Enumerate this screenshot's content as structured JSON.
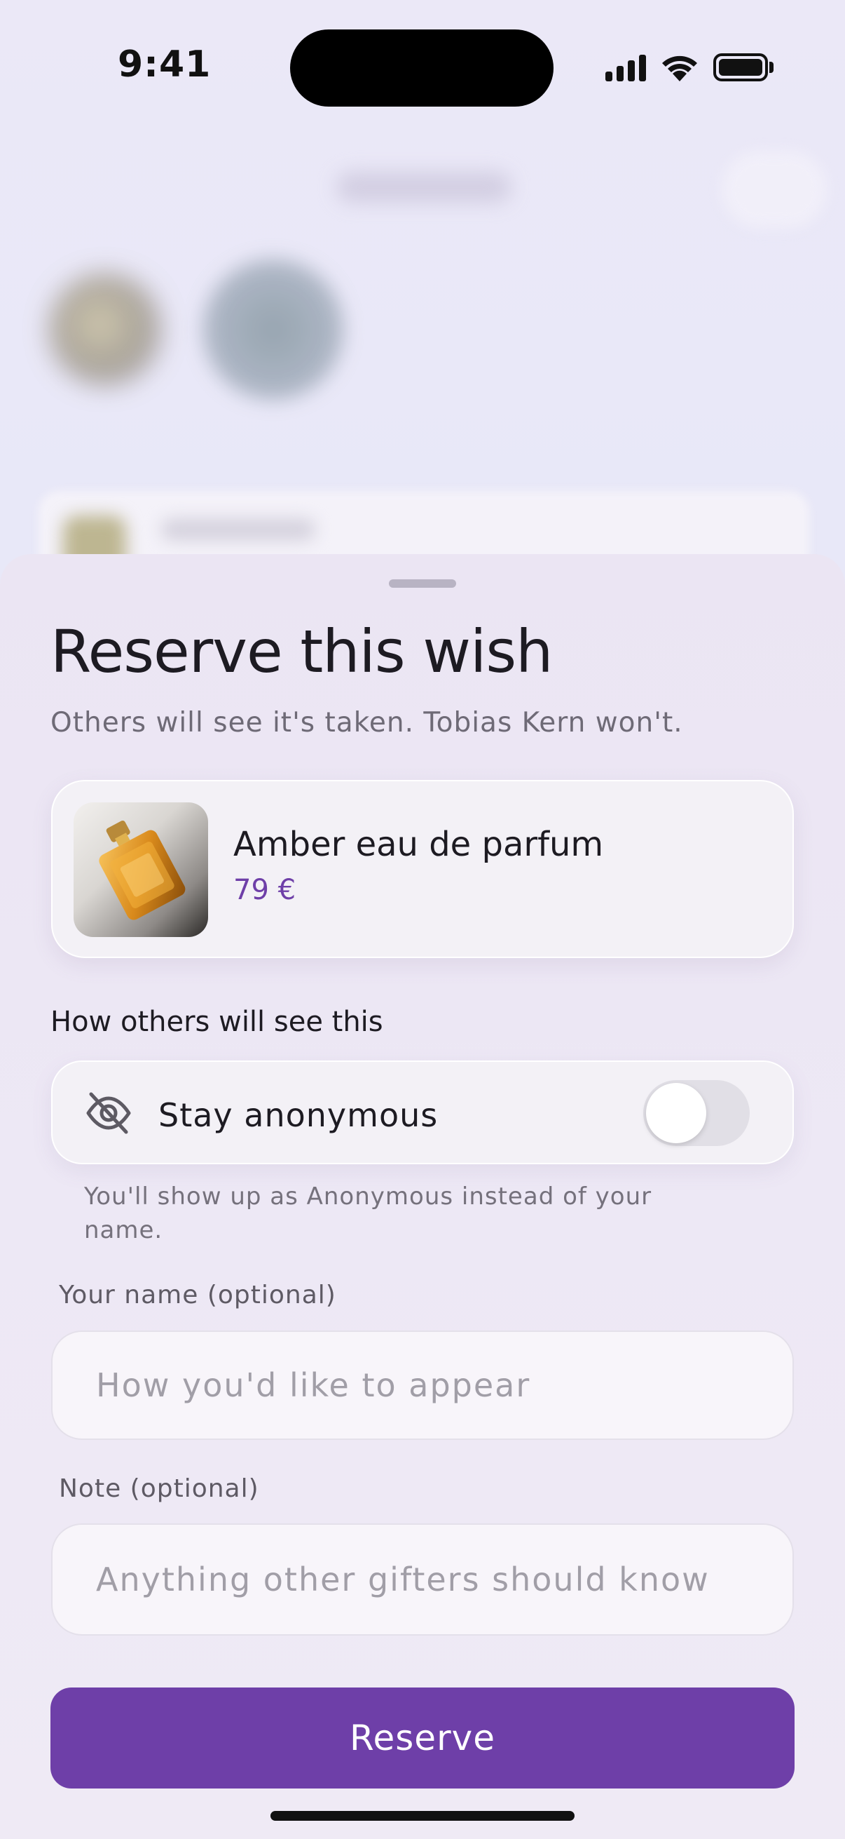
{
  "status_bar": {
    "time": "9:41"
  },
  "sheet": {
    "title": "Reserve this wish",
    "subtitle": "Others will see it's taken. Tobias Kern won't."
  },
  "item": {
    "name": "Amber eau de parfum",
    "price": "79 €"
  },
  "visibility": {
    "section_label": "How others will see this",
    "toggle_label": "Stay anonymous",
    "toggle_on": false,
    "help_text": "You'll show up as Anonymous instead of your name.",
    "icon": "eye-slash-icon"
  },
  "name_field": {
    "label": "Your name (optional)",
    "placeholder": "How you'd like to appear",
    "value": ""
  },
  "note_field": {
    "label": "Note (optional)",
    "placeholder": "Anything other gifters should know",
    "value": ""
  },
  "reserve_button": {
    "label": "Reserve"
  },
  "colors": {
    "accent": "#6e3fa8",
    "text_primary": "#1d1b22",
    "text_secondary": "#6e6a76"
  }
}
